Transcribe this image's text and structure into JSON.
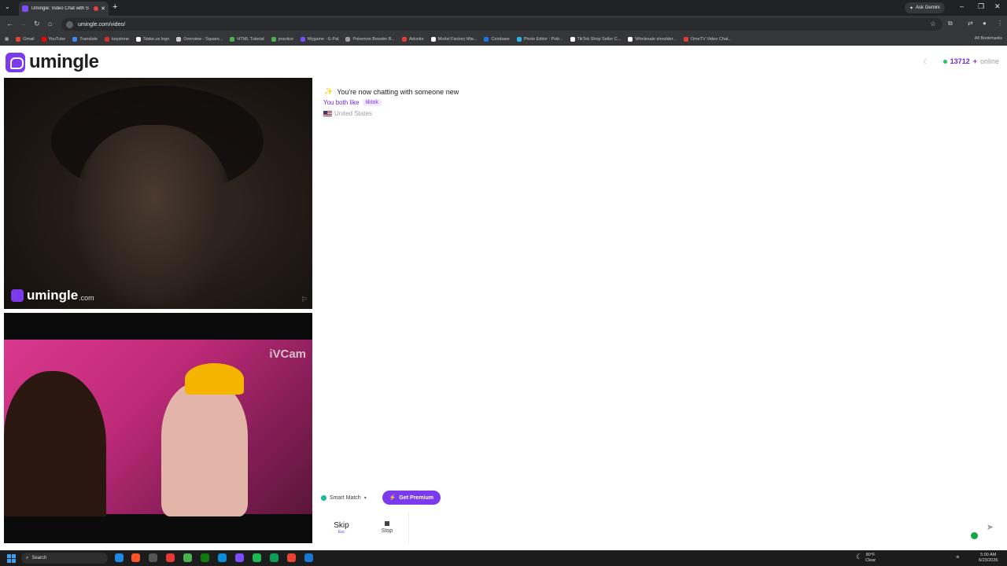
{
  "browser": {
    "tab_title": "Umingle: Video Chat with S",
    "tab_close": "✕",
    "new_tab": "+",
    "ask_gemini": "Ask Gemini",
    "url": "umingle.com/video/",
    "bookmarks": [
      {
        "label": "Gmail",
        "color": "#ea4335"
      },
      {
        "label": "YouTube",
        "color": "#ff0000"
      },
      {
        "label": "Translate",
        "color": "#4285f4"
      },
      {
        "label": "keystone",
        "color": "#d32f2f"
      },
      {
        "label": "Stake.us logo",
        "color": "#ffffff"
      },
      {
        "label": "Overview - Square...",
        "color": "#cccccc"
      },
      {
        "label": "HTML Tutorial",
        "color": "#4caf50"
      },
      {
        "label": "practice",
        "color": "#4caf50"
      },
      {
        "label": "Mygame - E-Pal",
        "color": "#7c4dff"
      },
      {
        "label": "Pokemon Booster B...",
        "color": "#9e9e9e"
      },
      {
        "label": "Adunite",
        "color": "#e53935"
      },
      {
        "label": "Model Factory Mia...",
        "color": "#ffffff"
      },
      {
        "label": "Coinbase",
        "color": "#1a73e8"
      },
      {
        "label": "Photo Editor : Pixlr...",
        "color": "#29b6f6"
      },
      {
        "label": "TikTok Shop Seller C...",
        "color": "#ffffff"
      },
      {
        "label": "Wholesale shoulder...",
        "color": "#ffffff"
      },
      {
        "label": "OmeTV Video Chat...",
        "color": "#e53935"
      }
    ],
    "all_bookmarks": "All Bookmarks"
  },
  "site": {
    "logo_text": "umingle",
    "online_count": "13712",
    "online_plus": "+",
    "online_label": "online",
    "watermark_text": "umingle",
    "watermark_domain": ".com",
    "camera_watermark": "iVCam"
  },
  "chat": {
    "status": "You're now chatting with someone new",
    "both_like_label": "You both like",
    "interest_tag": "tiktok",
    "country": "United States"
  },
  "controls": {
    "smart_match": "Smart Match",
    "get_premium": "Get Premium",
    "skip_label": "Skip",
    "skip_key": "Esc",
    "stop_label": "Stop",
    "send_icon": "➤"
  },
  "taskbar": {
    "search_label": "Search",
    "weather_temp": "80°F",
    "weather_desc": "Clear",
    "time": "5:00 AM",
    "date": "6/23/2026"
  },
  "colors": {
    "brand": "#7c3aed",
    "online_dot": "#22c55e"
  }
}
